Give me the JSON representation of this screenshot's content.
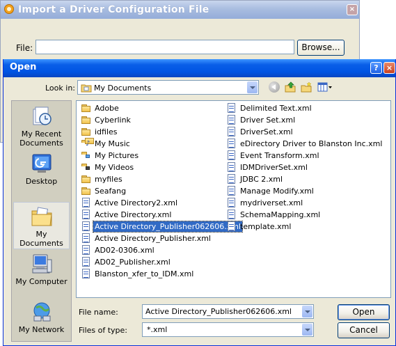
{
  "background_dialog": {
    "title": "Import a Driver Configuration File",
    "close": "×",
    "file_label": "File:",
    "file_value": "",
    "browse_label": "Browse..."
  },
  "open_dialog": {
    "title": "Open",
    "help": "?",
    "close": "×",
    "look_in_label": "Look in:",
    "look_in_value": "My Documents",
    "places": [
      {
        "label": "My Recent Documents",
        "icon": "recent-documents-icon"
      },
      {
        "label": "Desktop",
        "icon": "desktop-icon"
      },
      {
        "label": "My Documents",
        "icon": "my-documents-icon"
      },
      {
        "label": "My Computer",
        "icon": "my-computer-icon"
      },
      {
        "label": "My Network",
        "icon": "my-network-icon"
      }
    ],
    "files_col1": [
      {
        "name": "Adobe",
        "kind": "folder"
      },
      {
        "name": "Cyberlink",
        "kind": "folder"
      },
      {
        "name": "idfiles",
        "kind": "folder"
      },
      {
        "name": "My Music",
        "kind": "music"
      },
      {
        "name": "My Pictures",
        "kind": "pictures"
      },
      {
        "name": "My Videos",
        "kind": "videos"
      },
      {
        "name": "myfiles",
        "kind": "folder"
      },
      {
        "name": "Seafang",
        "kind": "folder"
      },
      {
        "name": "Active Directory2.xml",
        "kind": "xml"
      },
      {
        "name": "Active Directory.xml",
        "kind": "xml"
      },
      {
        "name": "Active Directory_Publisher062606.xml",
        "kind": "xml",
        "selected": true
      },
      {
        "name": "Active Directory_Publisher.xml",
        "kind": "xml"
      },
      {
        "name": "AD02-0306.xml",
        "kind": "xml"
      },
      {
        "name": "AD02_Publisher.xml",
        "kind": "xml"
      },
      {
        "name": "Blanston_xfer_to_IDM.xml",
        "kind": "xml"
      }
    ],
    "files_col2": [
      {
        "name": "Delimited Text.xml",
        "kind": "xml"
      },
      {
        "name": "Driver Set.xml",
        "kind": "xml"
      },
      {
        "name": "DriverSet.xml",
        "kind": "xml"
      },
      {
        "name": "eDirectory Driver to Blanston Inc.xml",
        "kind": "xml"
      },
      {
        "name": "Event Transform.xml",
        "kind": "xml"
      },
      {
        "name": "IDMDriverSet.xml",
        "kind": "xml"
      },
      {
        "name": "JDBC 2.xml",
        "kind": "xml"
      },
      {
        "name": "Manage Modify.xml",
        "kind": "xml"
      },
      {
        "name": "mydriverset.xml",
        "kind": "xml"
      },
      {
        "name": "SchemaMapping.xml",
        "kind": "xml"
      },
      {
        "name": "template.xml",
        "kind": "xml"
      }
    ],
    "file_name_label": "File name:",
    "file_name_value": "Active Directory_Publisher062606.xml",
    "files_of_type_label": "Files of type:",
    "files_of_type_value": "*.xml",
    "open_button": "Open",
    "cancel_button": "Cancel"
  }
}
